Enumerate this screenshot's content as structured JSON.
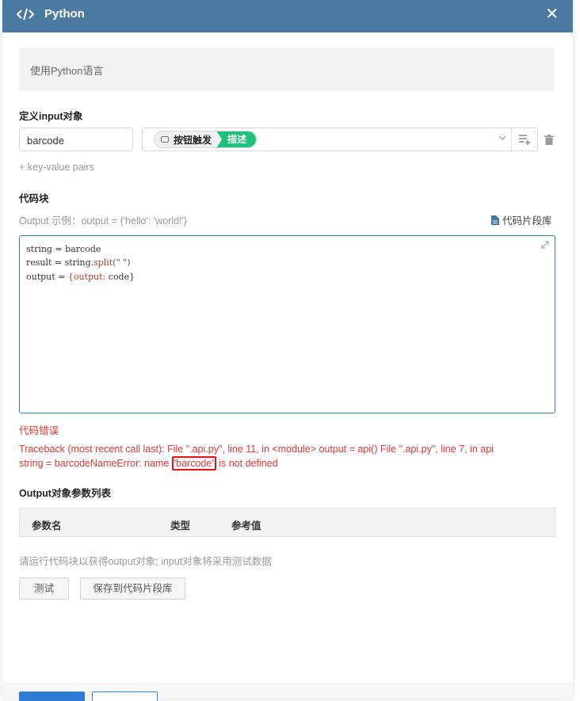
{
  "header": {
    "title": "Python"
  },
  "description": {
    "text": "使用Python语言"
  },
  "input_section": {
    "title": "定义input对象",
    "key_value": "barcode",
    "tag_label": "按钮触发",
    "tag_desc": "描述",
    "add_pairs": "+ key-value pairs"
  },
  "code_section": {
    "title": "代码块",
    "hint": "Output 示例：output = {'hello': 'world!'}",
    "snippet_link": "代码片段库",
    "lines": {
      "l1": "string = barcode",
      "l2_a": "result = string.",
      "l2_fn": "split",
      "l2_b": "(\" \")",
      "l3_a": "output = ",
      "l3_key": "{output:",
      "l3_b": " code}"
    }
  },
  "error": {
    "title": "代码错误",
    "text_pre": "Traceback (most recent call last): File \".api.py\", line 11, in <module> output = api() File \".api.py\", line 7, in api string = barcodeNameError: name ",
    "highlight": "'barcode'",
    "text_post": " is not defined"
  },
  "output_section": {
    "title": "Output对象参数列表",
    "columns": [
      "参数名",
      "类型",
      "参考值"
    ],
    "note": "请运行代码块以获得output对象; input对象将采用测试数据"
  },
  "buttons": {
    "test": "测试",
    "save_snippet": "保存到代码片段库"
  },
  "colors": {
    "header": "#4a7aa0",
    "error": "#e53935",
    "tag_green": "#1fc27a",
    "code_border": "#3f79a8"
  },
  "icons": [
    "code-icon",
    "close-icon",
    "chevron-down-icon",
    "list-add-icon",
    "trash-icon",
    "file-icon",
    "expand-icon"
  ]
}
